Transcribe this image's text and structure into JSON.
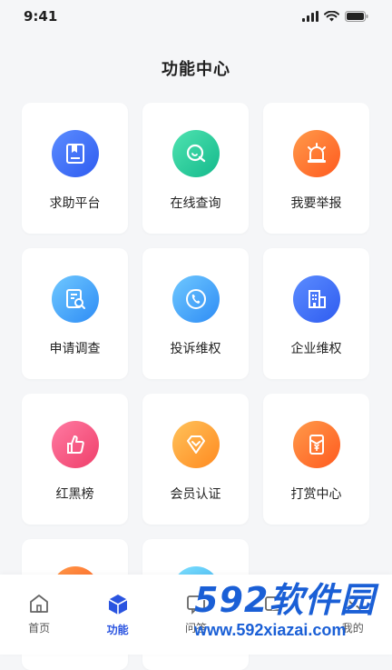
{
  "status": {
    "time": "9:41"
  },
  "page": {
    "title": "功能中心"
  },
  "features": [
    {
      "label": "求助平台",
      "icon": "bookmark-book-icon",
      "color": "#3d6df5"
    },
    {
      "label": "在线查询",
      "icon": "search-chat-icon",
      "color": "#1cc493"
    },
    {
      "label": "我要举报",
      "icon": "alarm-siren-icon",
      "color": "#ff6a2a"
    },
    {
      "label": "申请调查",
      "icon": "document-search-icon",
      "color": "#3a9af5"
    },
    {
      "label": "投诉维权",
      "icon": "phone-ring-icon",
      "color": "#3a9af5"
    },
    {
      "label": "企业维权",
      "icon": "building-icon",
      "color": "#3d6df5"
    },
    {
      "label": "红黑榜",
      "icon": "thumbs-chart-icon",
      "color": "#f04a74"
    },
    {
      "label": "会员认证",
      "icon": "diamond-badge-icon",
      "color": "#ff9a2a"
    },
    {
      "label": "打赏中心",
      "icon": "red-envelope-icon",
      "color": "#ff6a2a"
    }
  ],
  "tabs": [
    {
      "label": "首页",
      "icon": "home-icon",
      "active": false
    },
    {
      "label": "功能",
      "icon": "cube-icon",
      "active": true
    },
    {
      "label": "问答",
      "icon": "qa-icon",
      "active": false
    },
    {
      "label": "",
      "icon": "message-icon",
      "active": false
    },
    {
      "label": "我的",
      "icon": "profile-icon",
      "active": false
    }
  ],
  "watermark": {
    "brand": "592软件园",
    "url": "www.592xiazai.com"
  }
}
